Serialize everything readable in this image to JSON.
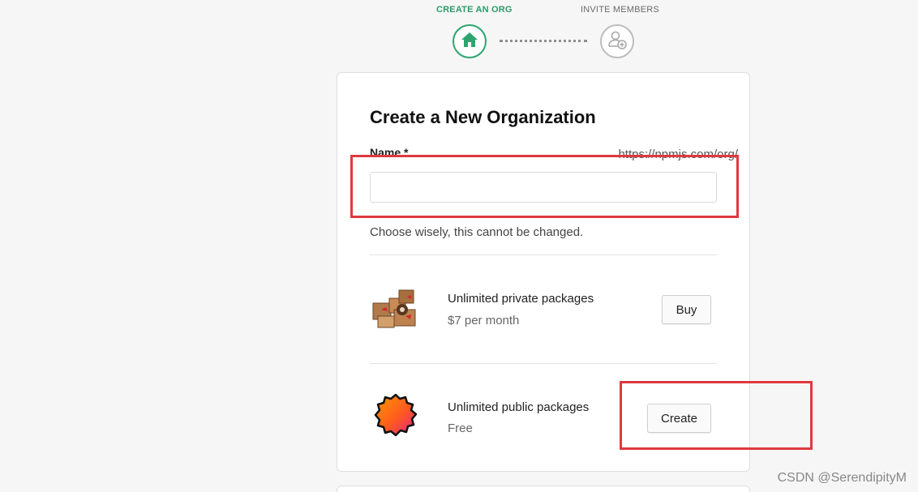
{
  "stepper": {
    "step1_label": "CREATE AN ORG",
    "step2_label": "INVITE MEMBERS",
    "step1_icon": "home-icon",
    "step2_icon": "add-user-icon",
    "active_color": "#2ea56f"
  },
  "form": {
    "title": "Create a New Organization",
    "name_label": "Name *",
    "url_prefix": "https://npmjs.com/org/",
    "name_value": "",
    "name_placeholder": "",
    "hint": "Choose wisely, this cannot be changed."
  },
  "plans": [
    {
      "title": "Unlimited private packages",
      "subtitle": "$7 per month",
      "button_label": "Buy",
      "icon": "boxes-illustration-icon"
    },
    {
      "title": "Unlimited public packages",
      "subtitle": "Free",
      "button_label": "Create",
      "icon": "orange-badge-icon"
    }
  ],
  "annotations": {
    "highlight_color": "#e0393e"
  },
  "watermark": "CSDN @SerendipityM"
}
